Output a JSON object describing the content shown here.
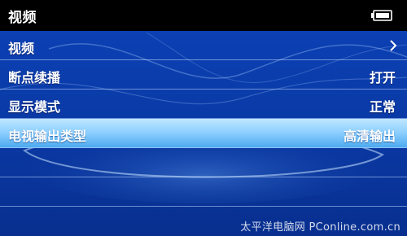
{
  "app": {
    "title": "视频",
    "battery_icon": "battery-icon"
  },
  "menu": {
    "items": [
      {
        "label": "视频",
        "value": "",
        "icon": "chevron-right-icon"
      },
      {
        "label": "断点续播",
        "value": "打开"
      },
      {
        "label": "显示模式",
        "value": "正常"
      },
      {
        "label": "电视输出类型",
        "value": "高清输出",
        "selected": true
      }
    ]
  },
  "colors": {
    "background": "#0a3aa8",
    "title_bar": "#000000",
    "selected_row": "#8fd0ff",
    "divider": "#bed7ff"
  },
  "watermark": "太平洋电脑网 PConline.com.cn"
}
